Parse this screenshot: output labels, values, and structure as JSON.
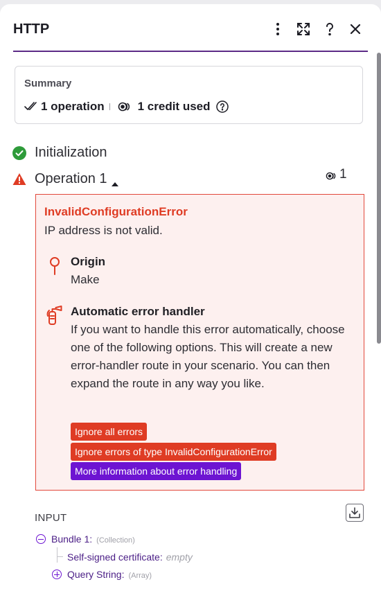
{
  "header": {
    "title": "HTTP",
    "icons": [
      "more-vertical-icon",
      "expand-icon",
      "help-icon",
      "close-icon"
    ]
  },
  "summary": {
    "title": "Summary",
    "operations": "1 operation",
    "credits": "1 credit used"
  },
  "steps": {
    "initialization": "Initialization",
    "operation": "Operation 1",
    "operation_credits": "1"
  },
  "error": {
    "name": "InvalidConfigurationError",
    "message": "IP address is not valid.",
    "origin_title": "Origin",
    "origin_value": "Make",
    "handler_title": "Automatic error handler",
    "handler_text": "If you want to handle this error automatically, choose one of the following options. This will create a new error-handler route in your scenario. You can then expand the route in any way you like.",
    "buttons": {
      "ignore_all": "Ignore all errors",
      "ignore_type": "Ignore errors of type InvalidConfigurationError",
      "more_info": "More information about error handling"
    }
  },
  "input": {
    "label": "INPUT",
    "bundle_key": "Bundle 1:",
    "bundle_type": "(Collection)",
    "cert_key": "Self-signed certificate:",
    "cert_value": "empty",
    "query_key": "Query String:",
    "query_type": "(Array)"
  },
  "colors": {
    "accent": "#5b2a86",
    "error": "#df3c24",
    "purple_button": "#6d14d2",
    "success": "#2e9b3a"
  }
}
